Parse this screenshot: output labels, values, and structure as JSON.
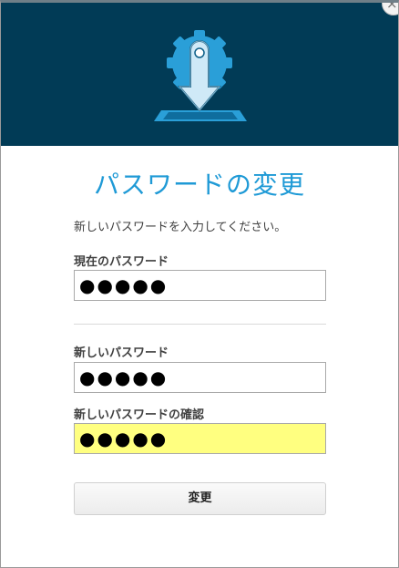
{
  "dialog": {
    "title": "パスワードの変更",
    "instruction": "新しいパスワードを入力してください。",
    "close_symbol": "×"
  },
  "fields": {
    "current_password": {
      "label": "現在のパスワード",
      "value": "●●●●●"
    },
    "new_password": {
      "label": "新しいパスワード",
      "value": "●●●●●"
    },
    "confirm_password": {
      "label": "新しいパスワードの確認",
      "value": "●●●●●"
    }
  },
  "buttons": {
    "submit_label": "変更"
  },
  "icons": {
    "logo": "download-gear-icon",
    "close": "close-icon"
  },
  "colors": {
    "header_bg": "#013b56",
    "title": "#1f9ad6",
    "highlight_field": "#ffff80"
  }
}
